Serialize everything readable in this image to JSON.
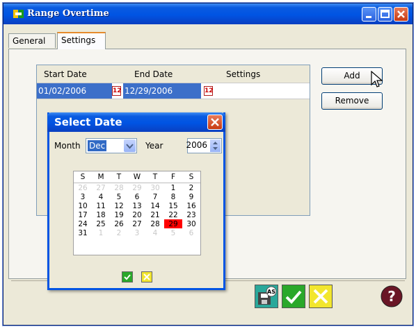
{
  "window": {
    "title": "Range Overtime"
  },
  "tabs": [
    {
      "label": "General"
    },
    {
      "label": "Settings"
    }
  ],
  "grid": {
    "columns": [
      "Start Date",
      "End Date",
      "Settings"
    ],
    "row": {
      "start": "01/02/2006",
      "end": "12/29/2006",
      "settings": "",
      "icon_text": "12"
    }
  },
  "buttons": {
    "add": "Add",
    "remove": "Remove"
  },
  "dialog": {
    "title": "Select Date",
    "month_label": "Month",
    "month_value": "Dec",
    "year_label": "Year",
    "year_value": "2006",
    "weekdays": [
      "S",
      "M",
      "T",
      "W",
      "T",
      "F",
      "S"
    ],
    "weeks": [
      [
        "26",
        "27",
        "28",
        "29",
        "30",
        "1",
        "2"
      ],
      [
        "3",
        "4",
        "5",
        "6",
        "7",
        "8",
        "9"
      ],
      [
        "10",
        "11",
        "12",
        "13",
        "14",
        "15",
        "16"
      ],
      [
        "17",
        "18",
        "19",
        "20",
        "21",
        "22",
        "23"
      ],
      [
        "24",
        "25",
        "26",
        "27",
        "28",
        "29",
        "30"
      ],
      [
        "31",
        "1",
        "2",
        "3",
        "4",
        "5",
        "6"
      ]
    ],
    "selected_day": "29"
  },
  "colors": {
    "titlebar": "#0054e3",
    "selection": "#316ac5",
    "selected_day": "#ff0000",
    "ok_green": "#2aa82a",
    "cancel_yellow": "#f2e62e"
  }
}
